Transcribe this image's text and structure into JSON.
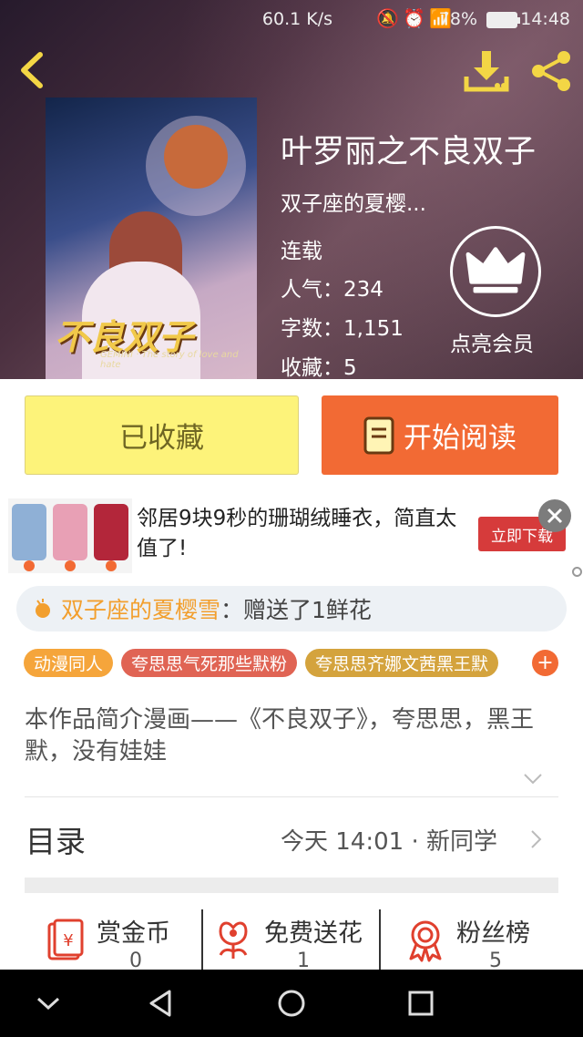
{
  "status_bar": {
    "net_speed": "60.1 K/s",
    "network": "4G",
    "battery": "78%",
    "time": "14:48"
  },
  "book": {
    "title": "叶罗丽之不良双子",
    "author": "双子座的夏樱...",
    "status": "连载",
    "popularity_label": "人气：",
    "popularity": "234",
    "words_label": "字数：",
    "words": "1,151",
    "favorites_label": "收藏：",
    "favorites": "5",
    "cover_title": "不良双子",
    "cover_subtitle": "GEMINI · The story of love and hate"
  },
  "vip": {
    "label": "点亮会员"
  },
  "actions": {
    "favorited": "已收藏",
    "read": "开始阅读"
  },
  "ad": {
    "text": "邻居9块9秒的珊瑚绒睡衣，简直太值了!",
    "button": "立即下载"
  },
  "gift": {
    "user": "双子座的夏樱雪",
    "message": "：赠送了1鲜花"
  },
  "tags": [
    {
      "label": "动漫同人",
      "color": "#f5a53b"
    },
    {
      "label": "夸思思气死那些默粉",
      "color": "#e06454"
    },
    {
      "label": "夸思思齐娜文茜黑王默",
      "color": "#d4a33d"
    }
  ],
  "tag_more": "+",
  "description": "本作品简介漫画——《不良双子》，夸思思，黑王默，没有娃娃",
  "toc": {
    "title": "目录",
    "latest": "今天 14:01 · 新同学"
  },
  "stats": [
    {
      "label": "赏金币",
      "value": "0",
      "icon": "red-envelope-icon"
    },
    {
      "label": "免费送花",
      "value": "1",
      "icon": "flower-icon"
    },
    {
      "label": "粉丝榜",
      "value": "5",
      "icon": "medal-icon"
    }
  ],
  "colors": {
    "accent": "#f26a34",
    "favorite_bg": "#fdf37a",
    "gift_user": "#f29f2e",
    "icon_yellow": "#f3d645"
  }
}
